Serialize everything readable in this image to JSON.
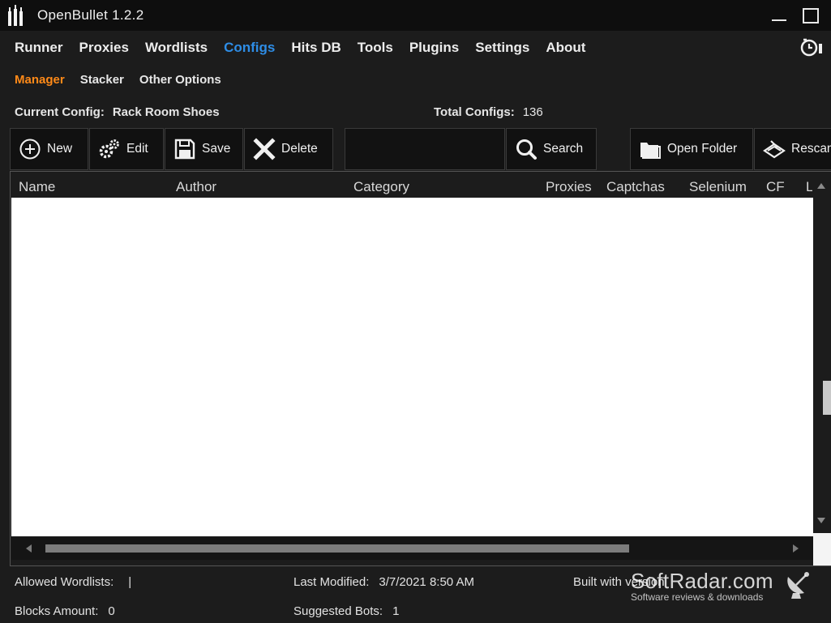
{
  "window": {
    "title": "OpenBullet 1.2.2"
  },
  "nav": {
    "items": [
      {
        "label": "Runner"
      },
      {
        "label": "Proxies"
      },
      {
        "label": "Wordlists"
      },
      {
        "label": "Configs",
        "active": true
      },
      {
        "label": "Hits DB"
      },
      {
        "label": "Tools"
      },
      {
        "label": "Plugins"
      },
      {
        "label": "Settings"
      },
      {
        "label": "About"
      }
    ],
    "active_color": "#2e8de6"
  },
  "subnav": {
    "items": [
      {
        "label": "Manager",
        "active": true
      },
      {
        "label": "Stacker"
      },
      {
        "label": "Other Options"
      }
    ],
    "active_color": "#ff8a18"
  },
  "info": {
    "current_config_label": "Current Config:",
    "current_config_value": "Rack Room Shoes",
    "total_configs_label": "Total Configs:",
    "total_configs_value": "136"
  },
  "toolbar": {
    "new_label": "New",
    "edit_label": "Edit",
    "save_label": "Save",
    "delete_label": "Delete",
    "search_value": "",
    "search_label": "Search",
    "open_folder_label": "Open Folder",
    "rescan_label": "Rescan"
  },
  "table": {
    "columns": [
      "Name",
      "Author",
      "Category",
      "Proxies",
      "Captchas",
      "Selenium",
      "CF",
      "L"
    ],
    "rows": []
  },
  "status": {
    "allowed_wordlists_label": "Allowed Wordlists:",
    "allowed_wordlists_value": "|",
    "last_modified_label": "Last Modified:",
    "last_modified_value": "3/7/2021 8:50 AM",
    "built_with_label": "Built with version",
    "blocks_amount_label": "Blocks Amount:",
    "blocks_amount_value": "0",
    "suggested_bots_label": "Suggested Bots:",
    "suggested_bots_value": "1"
  },
  "watermark": {
    "brand": "SoftRadar.com",
    "tagline": "Software reviews & downloads"
  },
  "icons": {
    "app_logo": "bottles-logo-icon",
    "new": "plus-circle-icon",
    "edit": "gears-icon",
    "save": "floppy-disk-icon",
    "delete": "x-icon",
    "search": "magnifier-icon",
    "open_folder": "folder-icon",
    "rescan": "scanner-icon",
    "top_right": "timer-icon"
  }
}
